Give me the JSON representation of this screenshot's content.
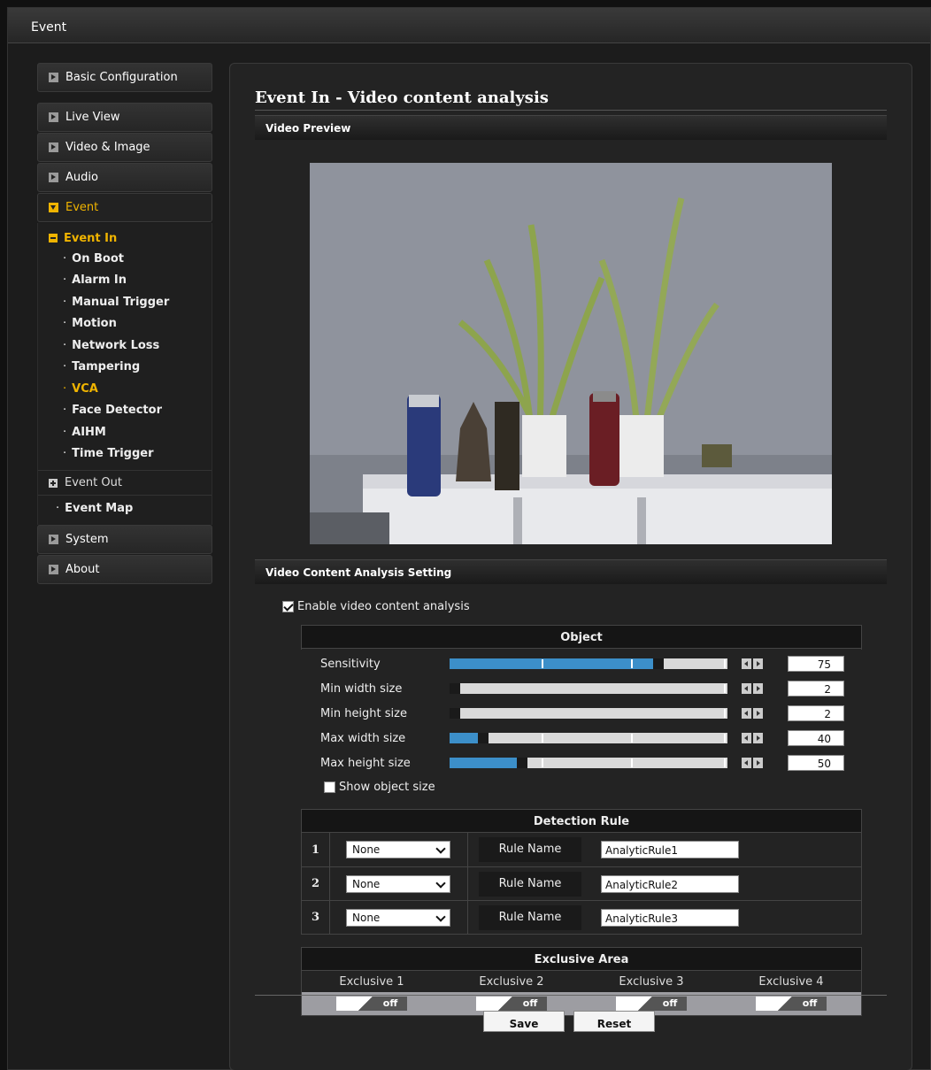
{
  "window": {
    "title": "Event"
  },
  "sidebar": {
    "basic": "Basic Configuration",
    "live_view": "Live View",
    "video_image": "Video & Image",
    "audio": "Audio",
    "event": "Event",
    "event_in": "Event In",
    "event_in_items": [
      "On Boot",
      "Alarm In",
      "Manual Trigger",
      "Motion",
      "Network Loss",
      "Tampering",
      "VCA",
      "Face Detector",
      "AIHM",
      "Time Trigger"
    ],
    "event_out": "Event Out",
    "event_map": "Event Map",
    "system": "System",
    "about": "About",
    "bullet": "·"
  },
  "main": {
    "title": "Event In - Video content analysis",
    "video_preview": "Video Preview",
    "vca_setting": "Video Content Analysis Setting",
    "enable_label": "Enable video content analysis",
    "enable_checked": true
  },
  "object": {
    "header": "Object",
    "sliders": [
      {
        "label": "Sensitivity",
        "value": "75",
        "fraction": 0.75
      },
      {
        "label": "Min width size",
        "value": "2",
        "fraction": 0.02
      },
      {
        "label": "Min height size",
        "value": "2",
        "fraction": 0.02
      },
      {
        "label": "Max width size",
        "value": "40",
        "fraction": 0.12
      },
      {
        "label": "Max height size",
        "value": "50",
        "fraction": 0.26
      }
    ],
    "show_size": "Show object size"
  },
  "detection": {
    "header": "Detection Rule",
    "rule_name_label": "Rule Name",
    "rows": [
      {
        "index": "1",
        "type": "None",
        "name": "AnalyticRule1"
      },
      {
        "index": "2",
        "type": "None",
        "name": "AnalyticRule2"
      },
      {
        "index": "3",
        "type": "None",
        "name": "AnalyticRule3"
      }
    ]
  },
  "exclusive": {
    "header": "Exclusive Area",
    "areas": [
      "Exclusive 1",
      "Exclusive 2",
      "Exclusive 3",
      "Exclusive 4"
    ],
    "state": "off"
  },
  "buttons": {
    "save": "Save",
    "reset": "Reset"
  },
  "colors": {
    "accent": "#f0b400",
    "slider_fill": "#3c8fc9"
  }
}
